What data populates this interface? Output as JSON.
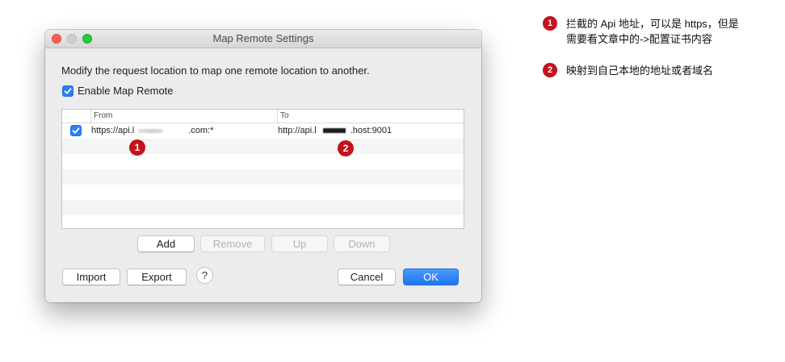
{
  "window": {
    "title": "Map Remote Settings"
  },
  "description": "Modify the request location to map one remote location to another.",
  "enable_map_remote": {
    "label": "Enable Map Remote",
    "checked": true
  },
  "table": {
    "columns": {
      "from": "From",
      "to": "To"
    },
    "rows": [
      {
        "enabled": true,
        "from": {
          "prefix": "https://api.l",
          "suffix": ".com:*"
        },
        "to": {
          "prefix": "http://api.l",
          "suffix": ".host:9001"
        }
      }
    ]
  },
  "table_buttons": {
    "add": "Add",
    "remove": "Remove",
    "up": "Up",
    "down": "Down"
  },
  "footer": {
    "import": "Import",
    "export": "Export",
    "help": "?",
    "cancel": "Cancel",
    "ok": "OK"
  },
  "markers": {
    "from": "1",
    "to": "2"
  },
  "notes": [
    {
      "number": "1",
      "lines": [
        "拦截的 Api 地址，可以是 https，但是",
        "需要看文章中的->配置证书内容"
      ]
    },
    {
      "number": "2",
      "lines": [
        "映射到自己本地的地址或者域名"
      ]
    }
  ],
  "colors": {
    "accent": "#2b7ff6",
    "marker": "#c5111c",
    "close": "#fe5f57",
    "minimize": "#cfcfcf",
    "zoom": "#28c840"
  }
}
